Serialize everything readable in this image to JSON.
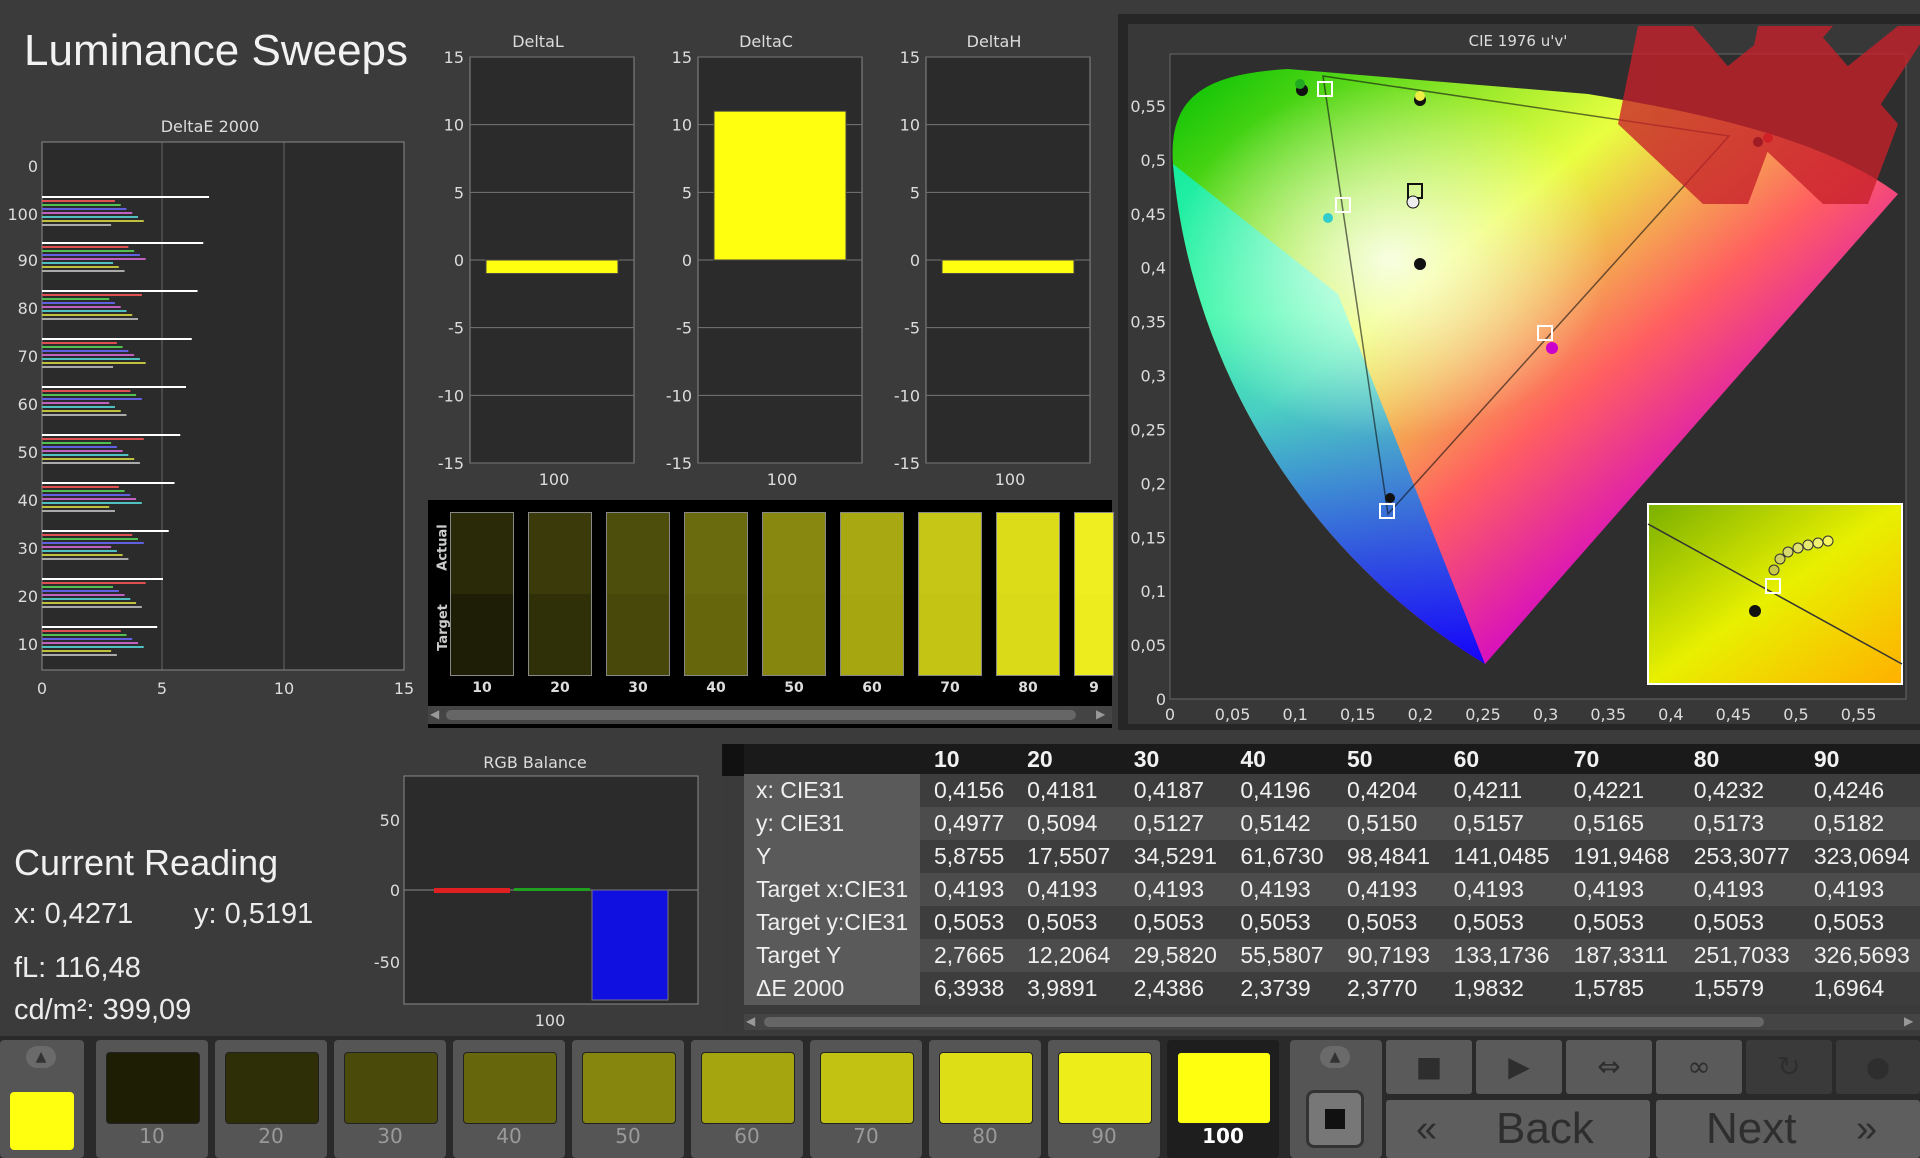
{
  "app_title": "Luminance Sweeps",
  "deltaE_chart": {
    "title": "DeltaE 2000",
    "x_ticks": [
      "0",
      "5",
      "10",
      "15"
    ],
    "y_ticks": [
      "0",
      "100",
      "90",
      "80",
      "70",
      "60",
      "50",
      "40",
      "30",
      "20",
      "10"
    ]
  },
  "delta_charts": [
    {
      "title": "DeltaL",
      "value": -1,
      "x_label": "100"
    },
    {
      "title": "DeltaC",
      "value": 11,
      "x_label": "100"
    },
    {
      "title": "DeltaH",
      "value": -1,
      "x_label": "100"
    }
  ],
  "delta_y_ticks": [
    "15",
    "10",
    "5",
    "0",
    "-5",
    "-10",
    "-15"
  ],
  "swatch_strip": {
    "actual_label": "Actual",
    "target_label": "Target",
    "labels": [
      "10",
      "20",
      "30",
      "40",
      "50",
      "60",
      "70",
      "80",
      "9"
    ]
  },
  "rgb_balance": {
    "title": "RGB Balance",
    "y_ticks": [
      "50",
      "0",
      "-50"
    ],
    "x_label": "100"
  },
  "cie_chart": {
    "title": "CIE 1976 u'v'",
    "x_ticks": [
      "0",
      "0,05",
      "0,1",
      "0,15",
      "0,2",
      "0,25",
      "0,3",
      "0,35",
      "0,4",
      "0,45",
      "0,5",
      "0,55"
    ],
    "y_ticks": [
      "0,55",
      "0,5",
      "0,45",
      "0,4",
      "0,35",
      "0,3",
      "0,25",
      "0,2",
      "0,15",
      "0,1",
      "0,05",
      "0"
    ]
  },
  "current_reading": {
    "title": "Current Reading",
    "x": "x: 0,4271",
    "y": "y: 0,5191",
    "fl": "fL: 116,48",
    "cd": "cd/m²: 399,09"
  },
  "table": {
    "columns": [
      "10",
      "20",
      "30",
      "40",
      "50",
      "60",
      "70",
      "80",
      "90"
    ],
    "rows": [
      {
        "label": "x: CIE31",
        "values": [
          "0,4156",
          "0,4181",
          "0,4187",
          "0,4196",
          "0,4204",
          "0,4211",
          "0,4221",
          "0,4232",
          "0,4246"
        ]
      },
      {
        "label": "y: CIE31",
        "values": [
          "0,4977",
          "0,5094",
          "0,5127",
          "0,5142",
          "0,5150",
          "0,5157",
          "0,5165",
          "0,5173",
          "0,5182"
        ]
      },
      {
        "label": "Y",
        "values": [
          "5,8755",
          "17,5507",
          "34,5291",
          "61,6730",
          "98,4841",
          "141,0485",
          "191,9468",
          "253,3077",
          "323,0694"
        ]
      },
      {
        "label": "Target x:CIE31",
        "values": [
          "0,4193",
          "0,4193",
          "0,4193",
          "0,4193",
          "0,4193",
          "0,4193",
          "0,4193",
          "0,4193",
          "0,4193"
        ]
      },
      {
        "label": "Target y:CIE31",
        "values": [
          "0,5053",
          "0,5053",
          "0,5053",
          "0,5053",
          "0,5053",
          "0,5053",
          "0,5053",
          "0,5053",
          "0,5053"
        ]
      },
      {
        "label": "Target Y",
        "values": [
          "2,7665",
          "12,2064",
          "29,5820",
          "55,5807",
          "90,7193",
          "133,1736",
          "187,3311",
          "251,7033",
          "326,5693"
        ]
      },
      {
        "label": "ΔE 2000",
        "values": [
          "6,3938",
          "3,9891",
          "2,4386",
          "2,3739",
          "2,3770",
          "1,9832",
          "1,5785",
          "1,5579",
          "1,6964"
        ]
      }
    ]
  },
  "bottom_swatches": [
    {
      "label": "10",
      "color": "#1e1e05"
    },
    {
      "label": "20",
      "color": "#2e2e07"
    },
    {
      "label": "30",
      "color": "#4a4a0a"
    },
    {
      "label": "40",
      "color": "#66660c"
    },
    {
      "label": "50",
      "color": "#86860e"
    },
    {
      "label": "60",
      "color": "#a5a510"
    },
    {
      "label": "70",
      "color": "#c2c212"
    },
    {
      "label": "80",
      "color": "#dede16"
    },
    {
      "label": "90",
      "color": "#eded1a"
    },
    {
      "label": "100",
      "color": "#ffff10"
    }
  ],
  "nav": {
    "back": "Back",
    "next": "Next"
  },
  "colors": {
    "yellow": "#ffff00",
    "background": "#3b3b3b",
    "watermark": "#cc2222"
  }
}
